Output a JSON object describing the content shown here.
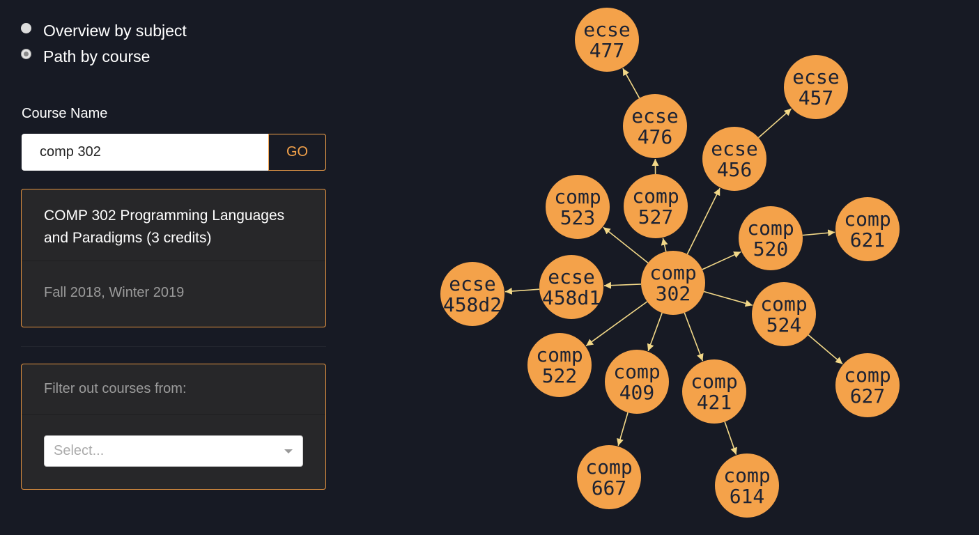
{
  "view_mode": {
    "options": [
      {
        "label": "Overview by subject",
        "checked": false
      },
      {
        "label": "Path by course",
        "checked": true
      }
    ]
  },
  "search": {
    "label": "Course Name",
    "value": "comp 302",
    "go_label": "GO"
  },
  "course_info": {
    "title": "COMP 302 Programming Languages and Paradigms (3 credits)",
    "terms": "Fall 2018, Winter 2019"
  },
  "filter": {
    "label": "Filter out courses from:",
    "placeholder": "Select..."
  },
  "colors": {
    "background": "#171a24",
    "accent": "#f4a24a",
    "edge": "#f2d888",
    "node_text": "#1c2233"
  },
  "graph": {
    "nodes": [
      {
        "id": "comp302",
        "line1": "comp",
        "line2": "302"
      },
      {
        "id": "comp527",
        "line1": "comp",
        "line2": "527"
      },
      {
        "id": "ecse476",
        "line1": "ecse",
        "line2": "476"
      },
      {
        "id": "ecse477",
        "line1": "ecse",
        "line2": "477"
      },
      {
        "id": "ecse456",
        "line1": "ecse",
        "line2": "456"
      },
      {
        "id": "ecse457",
        "line1": "ecse",
        "line2": "457"
      },
      {
        "id": "comp523",
        "line1": "comp",
        "line2": "523"
      },
      {
        "id": "comp520",
        "line1": "comp",
        "line2": "520"
      },
      {
        "id": "comp621",
        "line1": "comp",
        "line2": "621"
      },
      {
        "id": "ecse458d1",
        "line1": "ecse",
        "line2": "458d1"
      },
      {
        "id": "ecse458d2",
        "line1": "ecse",
        "line2": "458d2"
      },
      {
        "id": "comp524",
        "line1": "comp",
        "line2": "524"
      },
      {
        "id": "comp627",
        "line1": "comp",
        "line2": "627"
      },
      {
        "id": "comp522",
        "line1": "comp",
        "line2": "522"
      },
      {
        "id": "comp409",
        "line1": "comp",
        "line2": "409"
      },
      {
        "id": "comp421",
        "line1": "comp",
        "line2": "421"
      },
      {
        "id": "comp667",
        "line1": "comp",
        "line2": "667"
      },
      {
        "id": "comp614",
        "line1": "comp",
        "line2": "614"
      }
    ],
    "edges": [
      {
        "from": "comp302",
        "to": "comp527"
      },
      {
        "from": "comp527",
        "to": "ecse476"
      },
      {
        "from": "ecse476",
        "to": "ecse477"
      },
      {
        "from": "comp302",
        "to": "ecse456"
      },
      {
        "from": "ecse456",
        "to": "ecse457"
      },
      {
        "from": "comp302",
        "to": "comp523"
      },
      {
        "from": "comp302",
        "to": "comp520"
      },
      {
        "from": "comp520",
        "to": "comp621"
      },
      {
        "from": "comp302",
        "to": "ecse458d1"
      },
      {
        "from": "ecse458d1",
        "to": "ecse458d2"
      },
      {
        "from": "comp302",
        "to": "comp524"
      },
      {
        "from": "comp524",
        "to": "comp627"
      },
      {
        "from": "comp302",
        "to": "comp522"
      },
      {
        "from": "comp302",
        "to": "comp409"
      },
      {
        "from": "comp302",
        "to": "comp421"
      },
      {
        "from": "comp409",
        "to": "comp667"
      },
      {
        "from": "comp421",
        "to": "comp614"
      }
    ]
  }
}
